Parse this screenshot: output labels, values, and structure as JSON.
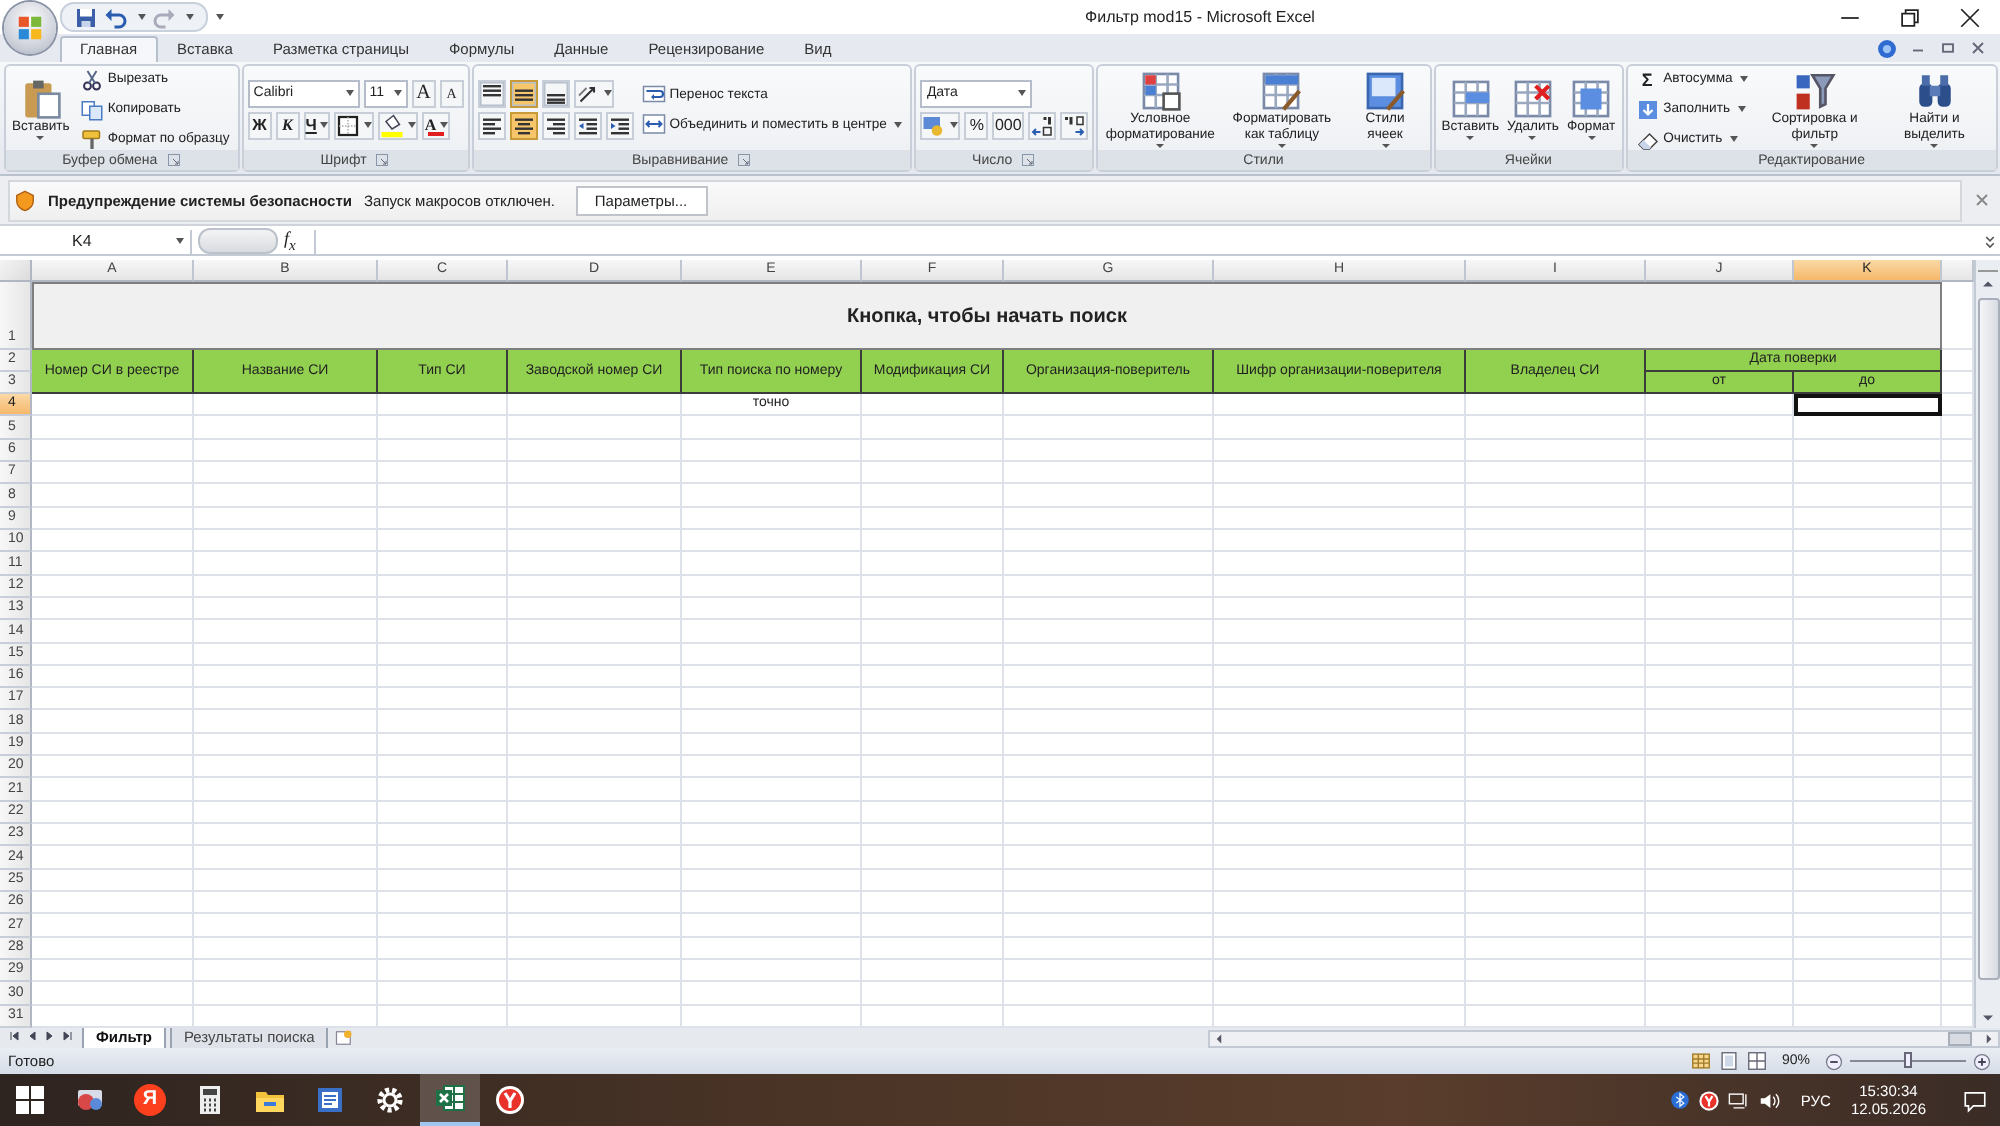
{
  "window": {
    "title": "Фильтр mod15 - Microsoft Excel"
  },
  "tabs": [
    {
      "label": "Главная",
      "selected": true
    },
    {
      "label": "Вставка",
      "selected": false
    },
    {
      "label": "Разметка страницы",
      "selected": false
    },
    {
      "label": "Формулы",
      "selected": false
    },
    {
      "label": "Данные",
      "selected": false
    },
    {
      "label": "Рецензирование",
      "selected": false
    },
    {
      "label": "Вид",
      "selected": false
    }
  ],
  "ribbon": [
    {
      "title": "Буфер обмена",
      "launcher": true,
      "cols": [
        [
          [
            {
              "kind": "large",
              "label": "Вставить",
              "dropdown": true
            }
          ]
        ],
        [
          [
            {
              "kind": "small",
              "label": "Вырезать"
            }
          ],
          [
            {
              "kind": "small",
              "label": "Копировать"
            }
          ],
          [
            {
              "kind": "small",
              "label": "Формат по образцу"
            }
          ]
        ]
      ]
    },
    {
      "title": "Шрифт",
      "launcher": true,
      "cols": [
        [
          [
            {
              "kind": "combo",
              "value": "Calibri",
              "wide": true
            },
            {
              "kind": "combo",
              "value": "11",
              "wide": false
            },
            {
              "kind": "text",
              "label": "A"
            },
            {
              "kind": "text",
              "label": "A"
            }
          ],
          [
            {
              "kind": "text",
              "label": "Ж"
            },
            {
              "kind": "text",
              "label": "К"
            },
            {
              "kind": "text",
              "label": "Ч",
              "dropdown": true
            },
            {
              "kind": "icon",
              "dropdown": true
            },
            {
              "kind": "icon",
              "dropdown": true
            },
            {
              "kind": "text",
              "label": "A",
              "color": "#e02020",
              "dropdown": true
            }
          ]
        ]
      ]
    },
    {
      "title": "Выравнивание",
      "launcher": true,
      "cols": [
        [
          [
            {
              "kind": "icon",
              "selected": false
            },
            {
              "kind": "icon",
              "selected": true
            },
            {
              "kind": "icon",
              "selected": false
            },
            {
              "kind": "icon",
              "selected": false,
              "dropdown": true
            }
          ],
          [
            {
              "kind": "icon",
              "selected": false
            },
            {
              "kind": "icon",
              "selected": true
            },
            {
              "kind": "icon",
              "selected": false
            },
            {
              "kind": "icon",
              "selected": false
            },
            {
              "kind": "icon",
              "selected": false
            }
          ]
        ],
        [
          [
            {
              "kind": "small",
              "label": "Перенос текста"
            }
          ],
          [
            {
              "kind": "small",
              "label": "Объединить и поместить в центре",
              "dropdown": true
            }
          ]
        ]
      ]
    },
    {
      "title": "Число",
      "launcher": true,
      "cols": [
        [
          [
            {
              "kind": "combo",
              "value": "Дата",
              "wide": true
            }
          ],
          [
            {
              "kind": "icon",
              "dropdown": true
            },
            {
              "kind": "text",
              "label": "%"
            },
            {
              "kind": "text",
              "label": "000"
            },
            {
              "kind": "icon"
            },
            {
              "kind": "icon"
            }
          ]
        ]
      ]
    },
    {
      "title": "Стили",
      "launcher": false,
      "cols": [
        [
          [
            {
              "kind": "large",
              "label": "Условное форматирование",
              "dropdown": true
            }
          ]
        ],
        [
          [
            {
              "kind": "large",
              "label": "Форматировать как таблицу",
              "dropdown": true
            }
          ]
        ],
        [
          [
            {
              "kind": "large",
              "label": "Стили ячеек",
              "dropdown": true
            }
          ]
        ]
      ]
    },
    {
      "title": "Ячейки",
      "launcher": false,
      "cols": [
        [
          [
            {
              "kind": "large",
              "label": "Вставить",
              "dropdown": true
            }
          ]
        ],
        [
          [
            {
              "kind": "large",
              "label": "Удалить",
              "dropdown": true
            }
          ]
        ],
        [
          [
            {
              "kind": "large",
              "label": "Формат",
              "dropdown": true
            }
          ]
        ]
      ]
    },
    {
      "title": "Редактирование",
      "launcher": false,
      "cols": [
        [
          [
            {
              "kind": "small",
              "glyph": "Σ",
              "label": "Автосумма",
              "dropdown": true
            }
          ],
          [
            {
              "kind": "small",
              "label": "Заполнить",
              "dropdown": true
            }
          ],
          [
            {
              "kind": "small",
              "label": "Очистить",
              "dropdown": true
            }
          ]
        ],
        [
          [
            {
              "kind": "large",
              "label": "Сортировка и фильтр",
              "dropdown": true
            }
          ]
        ],
        [
          [
            {
              "kind": "large",
              "label": "Найти и выделить",
              "dropdown": true
            }
          ]
        ]
      ]
    }
  ],
  "security_bar": {
    "title": "Предупреждение системы безопасности",
    "message": "Запуск макросов отключен.",
    "button": "Параметры..."
  },
  "formula_bar": {
    "name_box": "K4",
    "function_label": "f$_{x}$"
  },
  "sheet": {
    "columns": [
      {
        "label": "A",
        "selected": false
      },
      {
        "label": "B",
        "selected": false
      },
      {
        "label": "C",
        "selected": false
      },
      {
        "label": "D",
        "selected": false
      },
      {
        "label": "E",
        "selected": false
      },
      {
        "label": "F",
        "selected": false
      },
      {
        "label": "G",
        "selected": false
      },
      {
        "label": "H",
        "selected": false
      },
      {
        "label": "I",
        "selected": false
      },
      {
        "label": "J",
        "selected": false
      },
      {
        "label": "K",
        "selected": true
      }
    ],
    "rows": [
      {
        "label": "1",
        "selected": false
      },
      {
        "label": "2",
        "selected": false
      },
      {
        "label": "3",
        "selected": false
      },
      {
        "label": "4",
        "selected": true
      },
      {
        "label": "5",
        "selected": false
      },
      {
        "label": "6",
        "selected": false
      },
      {
        "label": "7",
        "selected": false
      },
      {
        "label": "8",
        "selected": false
      },
      {
        "label": "9",
        "selected": false
      },
      {
        "label": "10",
        "selected": false
      },
      {
        "label": "11",
        "selected": false
      },
      {
        "label": "12",
        "selected": false
      },
      {
        "label": "13",
        "selected": false
      },
      {
        "label": "14",
        "selected": false
      },
      {
        "label": "15",
        "selected": false
      },
      {
        "label": "16",
        "selected": false
      },
      {
        "label": "17",
        "selected": false
      },
      {
        "label": "18",
        "selected": false
      },
      {
        "label": "19",
        "selected": false
      },
      {
        "label": "20",
        "selected": false
      },
      {
        "label": "21",
        "selected": false
      },
      {
        "label": "22",
        "selected": false
      },
      {
        "label": "23",
        "selected": false
      },
      {
        "label": "24",
        "selected": false
      },
      {
        "label": "25",
        "selected": false
      },
      {
        "label": "26",
        "selected": false
      },
      {
        "label": "27",
        "selected": false
      },
      {
        "label": "28",
        "selected": false
      },
      {
        "label": "29",
        "selected": false
      },
      {
        "label": "30",
        "selected": false
      },
      {
        "label": "31",
        "selected": false
      }
    ],
    "title": "Кнопка, чтобы начать поиск",
    "headers": [
      "Номер СИ в реестре",
      "Название СИ",
      "Тип СИ",
      "Заводской номер СИ",
      "Тип поиска по номеру",
      "Модификация СИ",
      "Организация-поверитель",
      "Шифр организации-поверителя",
      "Владелец СИ"
    ],
    "date_header": "Дата поверки",
    "date_subheaders": [
      "от",
      "до"
    ],
    "input_row": {
      "search_type": "точно"
    }
  },
  "sheet_tabs": [
    {
      "label": "Фильтр",
      "selected": true
    },
    {
      "label": "Результаты поиска",
      "selected": false
    }
  ],
  "status_bar": {
    "text": "Готово",
    "zoom": "90%",
    "zoom_slider": {
      "level": 0.5
    }
  },
  "taskbar": {
    "apps": [
      {
        "kind": "start",
        "active": false
      },
      {
        "kind": "remote",
        "active": false
      },
      {
        "kind": "yandex",
        "glyph": "Я",
        "active": false
      },
      {
        "kind": "calculator",
        "active": false
      },
      {
        "kind": "explorer",
        "active": false
      },
      {
        "kind": "document",
        "active": false
      },
      {
        "kind": "settings",
        "active": false
      },
      {
        "kind": "excel",
        "active": true
      },
      {
        "kind": "browser",
        "active": false
      }
    ],
    "language": "РУС",
    "time": "15:30:34",
    "date": "12.05.2026"
  }
}
